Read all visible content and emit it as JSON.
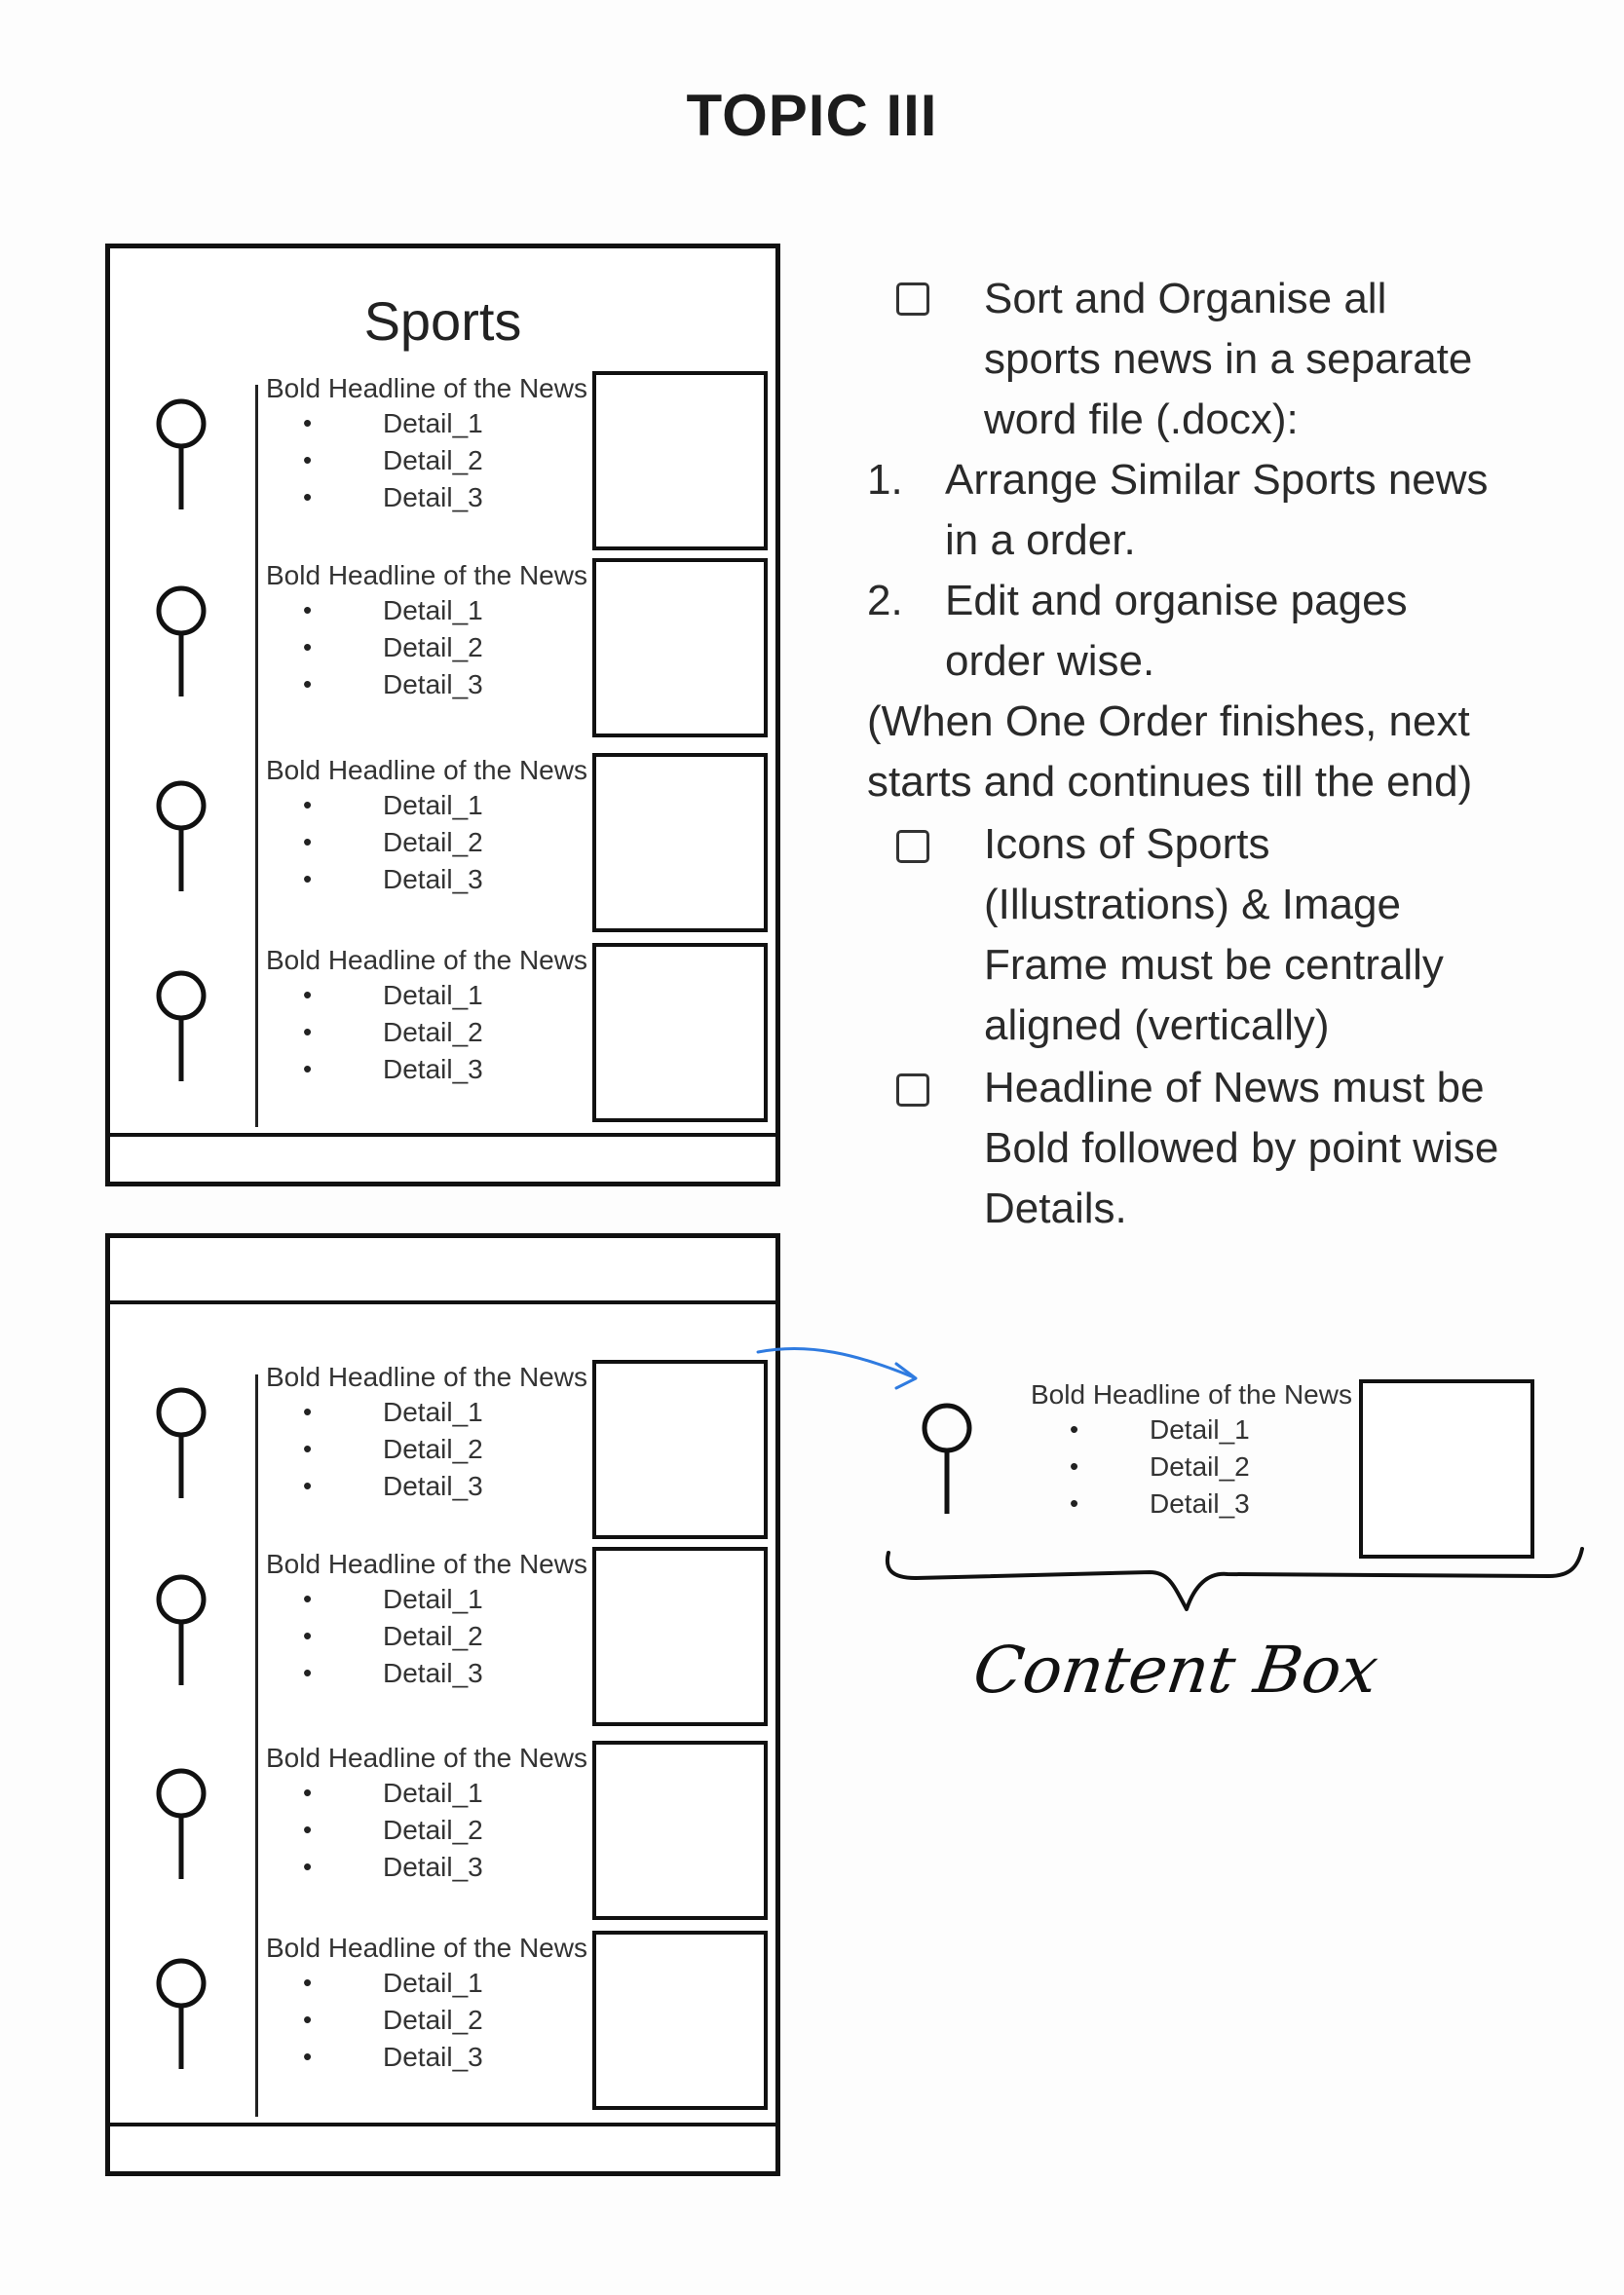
{
  "document_title": "TOPIC III",
  "page_heading": "Sports",
  "news_item": {
    "headline": "Bold Headline of the News",
    "details": [
      "Detail_1",
      "Detail_2",
      "Detail_3"
    ],
    "bullet": "•"
  },
  "notes": {
    "checklist_1": [
      "Sort and Organise all",
      "sports news in a separate",
      "word file (.docx):"
    ],
    "steps": [
      {
        "number": "1.",
        "lines": [
          "Arrange Similar Sports news",
          "in a order."
        ]
      },
      {
        "number": "2.",
        "lines": [
          "Edit and organise pages",
          "order wise."
        ]
      }
    ],
    "paren_note": [
      "(When One Order finishes, next",
      "starts and continues till the end)"
    ],
    "checklist_2": [
      "Icons of Sports",
      "(Illustrations) & Image",
      "Frame must be centrally",
      "aligned (vertically)"
    ],
    "checklist_3": [
      "Headline of News must be",
      "Bold followed by point wise",
      "Details."
    ]
  },
  "annotation": {
    "label": "Content Box",
    "arrow_color": "#2f7be0"
  }
}
